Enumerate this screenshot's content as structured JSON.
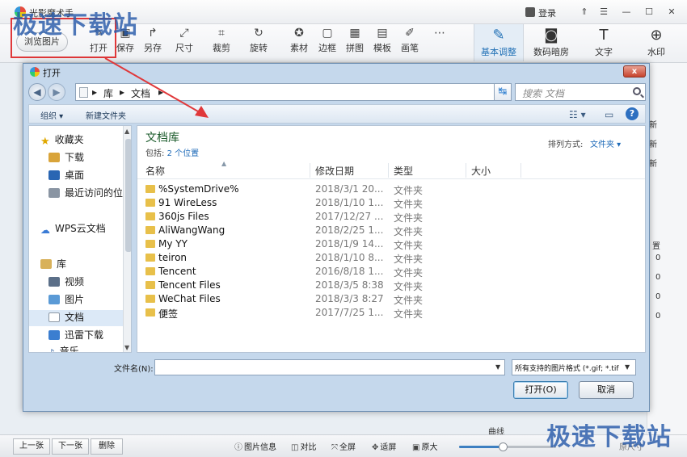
{
  "app": {
    "title": "光影魔术手",
    "login": "登录",
    "min": "—",
    "max": "☐",
    "close": "✕",
    "menu": "☰",
    "browse_btn": "浏览图片",
    "toolbar": [
      {
        "label": "打开",
        "icon": "open-icon",
        "glyph": "✎"
      },
      {
        "label": "保存",
        "icon": "save-icon",
        "glyph": "▣"
      },
      {
        "label": "另存",
        "icon": "saveas-icon",
        "glyph": "↱"
      },
      {
        "label": "尺寸",
        "icon": "resize-icon",
        "glyph": "⤢"
      },
      {
        "label": "裁剪",
        "icon": "crop-icon",
        "glyph": "⌗"
      },
      {
        "label": "旋转",
        "icon": "rotate-icon",
        "glyph": "↻"
      },
      {
        "label": "素材",
        "icon": "material-icon",
        "glyph": "✪"
      },
      {
        "label": "边框",
        "icon": "border-icon",
        "glyph": "▢"
      },
      {
        "label": "拼图",
        "icon": "puzzle-icon",
        "glyph": "▦"
      },
      {
        "label": "模板",
        "icon": "template-icon",
        "glyph": "▤"
      },
      {
        "label": "画笔",
        "icon": "brush-icon",
        "glyph": "✐"
      },
      {
        "label": "",
        "icon": "more-icon",
        "glyph": "⋯"
      }
    ],
    "right_tools": [
      {
        "label": "基本调整",
        "icon": "adjust-icon",
        "glyph": "✎"
      },
      {
        "label": "数码暗房",
        "icon": "darkroom-icon",
        "glyph": "◙"
      },
      {
        "label": "文字",
        "icon": "text-icon",
        "glyph": "T"
      },
      {
        "label": "水印",
        "icon": "watermark-icon",
        "glyph": "⊕"
      }
    ],
    "right_panel_fragments": [
      "新",
      "新",
      "新",
      "置",
      "0",
      "0",
      "0",
      "0",
      "曲线"
    ],
    "bottom": {
      "prev": "上一张",
      "next": "下一张",
      "delete": "删除",
      "info": "图片信息",
      "compare": "对比",
      "fullscreen": "全屏",
      "fit": "适屏",
      "original": "原大",
      "zoom_fraction": 0.45,
      "zoom_label": "原尺寸"
    }
  },
  "watermark_text": "极速下载站",
  "dialog": {
    "title": "打开",
    "close": "x",
    "crumbs": [
      "库",
      "文档"
    ],
    "search_placeholder": "搜索 文档",
    "organize": "组织 ▾",
    "new_folder": "新建文件夹",
    "nav": {
      "favorites": "收藏夹",
      "download": "下载",
      "desktop": "桌面",
      "recent": "最近访问的位置",
      "wps": "WPS云文档",
      "libraries": "库",
      "videos": "视频",
      "pictures": "图片",
      "documents": "文档",
      "xunlei": "迅雷下载",
      "music": "音乐"
    },
    "library_title": "文档库",
    "library_sub_prefix": "包括: ",
    "library_sub_link": "2 个位置",
    "sort_label": "排列方式:",
    "sort_value": "文件夹 ▾",
    "columns": {
      "name": "名称",
      "date": "修改日期",
      "type": "类型",
      "size": "大小"
    },
    "files": [
      {
        "name": "%SystemDrive%",
        "date": "2018/3/1 20...",
        "type": "文件夹"
      },
      {
        "name": "91 WireLess",
        "date": "2018/1/10 1...",
        "type": "文件夹"
      },
      {
        "name": "360js Files",
        "date": "2017/12/27 ...",
        "type": "文件夹"
      },
      {
        "name": "AliWangWang",
        "date": "2018/2/25 1...",
        "type": "文件夹"
      },
      {
        "name": "My YY",
        "date": "2018/1/9 14...",
        "type": "文件夹"
      },
      {
        "name": "teiron",
        "date": "2018/1/10 8...",
        "type": "文件夹"
      },
      {
        "name": "Tencent",
        "date": "2016/8/18 1...",
        "type": "文件夹"
      },
      {
        "name": "Tencent Files",
        "date": "2018/3/5 8:38",
        "type": "文件夹"
      },
      {
        "name": "WeChat Files",
        "date": "2018/3/3 8:27",
        "type": "文件夹"
      },
      {
        "name": "便签",
        "date": "2017/7/25 1...",
        "type": "文件夹"
      }
    ],
    "filename_label": "文件名(N):",
    "filename_value": "",
    "filetype": "所有支持的图片格式 (*.gif; *.tif",
    "open_btn": "打开(O)",
    "cancel_btn": "取消"
  },
  "colors": {
    "accent": "#1f6fb5",
    "highlight": "#e0383a",
    "folder": "#e8c04a"
  }
}
